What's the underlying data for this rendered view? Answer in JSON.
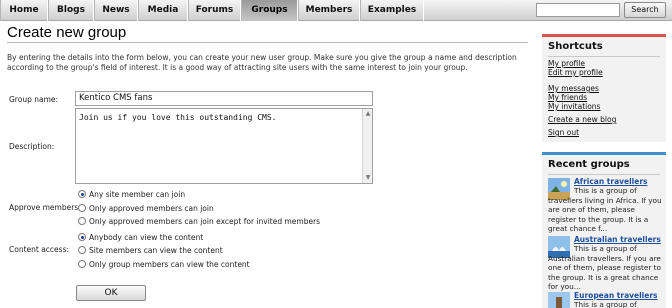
{
  "nav": {
    "items": [
      {
        "label": "Home",
        "active": false
      },
      {
        "label": "Blogs",
        "active": false
      },
      {
        "label": "News",
        "active": false
      },
      {
        "label": "Media",
        "active": false
      },
      {
        "label": "Forums",
        "active": false
      },
      {
        "label": "Groups",
        "active": true
      },
      {
        "label": "Members",
        "active": false
      },
      {
        "label": "Examples",
        "active": false
      }
    ],
    "search_value": "",
    "search_button": "Search"
  },
  "main": {
    "title": "Create new group",
    "intro": "By entering the details into the form below, you can create your new user group. Make sure you give the group a  name and description according to the group's field of interest. It is a good way of attracting site users with the same interest to join your group.",
    "group_name_label": "Group name:",
    "group_name_value": "Kentico CMS fans",
    "description_label": "Description:",
    "description_value": "Join us if you love this outstanding CMS.",
    "approve_label": "Approve members:",
    "approve_options": [
      {
        "label": "Any site member can join",
        "selected": true
      },
      {
        "label": "Only approved members can join",
        "selected": false
      },
      {
        "label": "Only approved members can join except for invited members",
        "selected": false
      }
    ],
    "access_label": "Content access:",
    "access_options": [
      {
        "label": "Anybody can view the content",
        "selected": true
      },
      {
        "label": "Site members can view the content",
        "selected": false
      },
      {
        "label": "Only group members can view the content",
        "selected": false
      }
    ],
    "ok_label": "OK"
  },
  "sidebar": {
    "shortcuts_title": "Shortcuts",
    "shortcuts": [
      "My profile",
      "Edit my profile",
      "My messages",
      "My friends",
      "My invitations",
      "Create a new blog",
      "Sign out"
    ],
    "recent_title": "Recent groups",
    "recent_groups": [
      {
        "title": "African travellers",
        "description": "This is a group of travellers living in Africa. If you are one of them, please register to the group. It is a great chance f..."
      },
      {
        "title": "Australian travellers",
        "description": "This is a group of Australian travellers. If you are one of them, please register to the group. It is a great chance for you..."
      },
      {
        "title": "European travellers",
        "description": "This is a group of Europe"
      }
    ]
  },
  "colors": {
    "shortcuts_accent": "#d9534f",
    "recent_accent": "#3b8fcf",
    "link_blue": "#1f4f9e"
  }
}
